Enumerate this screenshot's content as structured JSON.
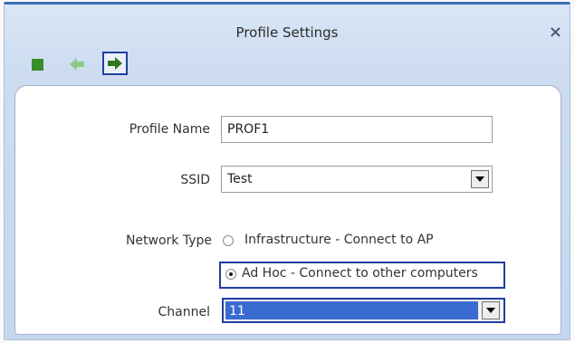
{
  "window": {
    "title": "Profile Settings",
    "close_label": "×"
  },
  "toolbar": {
    "stop_icon": "stop-icon",
    "back_icon": "back-arrow-icon",
    "next_icon": "forward-arrow-icon"
  },
  "form": {
    "profile_name_label": "Profile Name",
    "profile_name_value": "PROF1",
    "ssid_label": "SSID",
    "ssid_value": "Test",
    "network_type_label": "Network Type",
    "network_type_options": [
      {
        "label": "Infrastructure - Connect to AP",
        "selected": false
      },
      {
        "label": "Ad Hoc - Connect to other computers",
        "selected": true
      }
    ],
    "channel_label": "Channel",
    "channel_value": "11"
  },
  "colors": {
    "title_bar": "#3b6fb4",
    "highlight": "#1f3f9f",
    "selection": "#3a6bd0",
    "toolbar_green": "#3a8d2d"
  }
}
